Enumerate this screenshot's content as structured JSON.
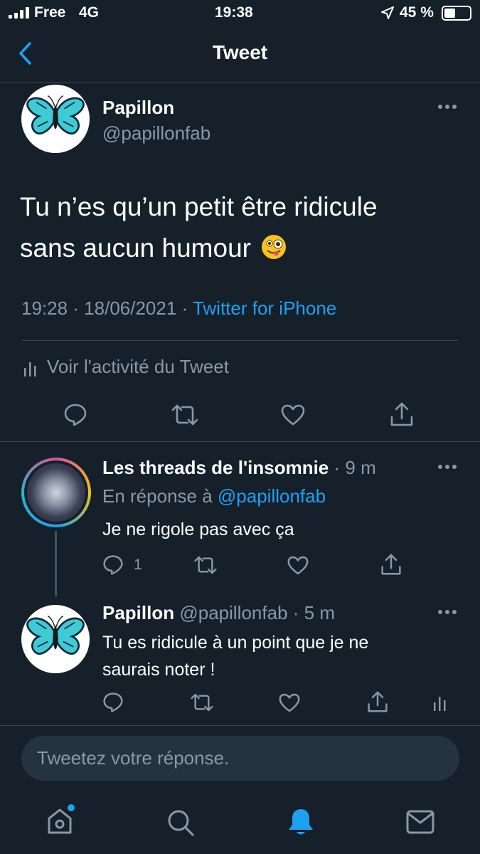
{
  "status_bar": {
    "carrier": "Free",
    "network": "4G",
    "time": "19:38",
    "battery": "45 %",
    "battery_level": 0.45
  },
  "header": {
    "title": "Tweet"
  },
  "main_tweet": {
    "display_name": "Papillon",
    "handle": "@papillonfab",
    "text_line1": "Tu n’es qu’un petit être ridicule",
    "text_line2": "sans aucun humour",
    "emoji": "😜",
    "timestamp": "19:28 · 18/06/2021 ·",
    "source": "Twitter for iPhone",
    "activity_label": "Voir l'activité du Tweet"
  },
  "replies": [
    {
      "display_name": "Les threads de l'insomnie",
      "age": "· 9 m",
      "reply_to_prefix": "En réponse à",
      "reply_to_handle": "@papillonfab",
      "text": "Je ne rigole pas avec ça",
      "reply_count": "1"
    },
    {
      "display_name": "Papillon",
      "handle": "@papillonfab",
      "age": "· 5 m",
      "text_line1": "Tu es ridicule à un point que je ne",
      "text_line2": "saurais noter !"
    }
  ],
  "compose": {
    "placeholder": "Tweetez votre réponse."
  },
  "tab_bar": {
    "active": "notifications"
  },
  "colors": {
    "background": "#15202b",
    "accent": "#1da1f2",
    "secondary_text": "#8899a6",
    "divider": "#38444d"
  }
}
